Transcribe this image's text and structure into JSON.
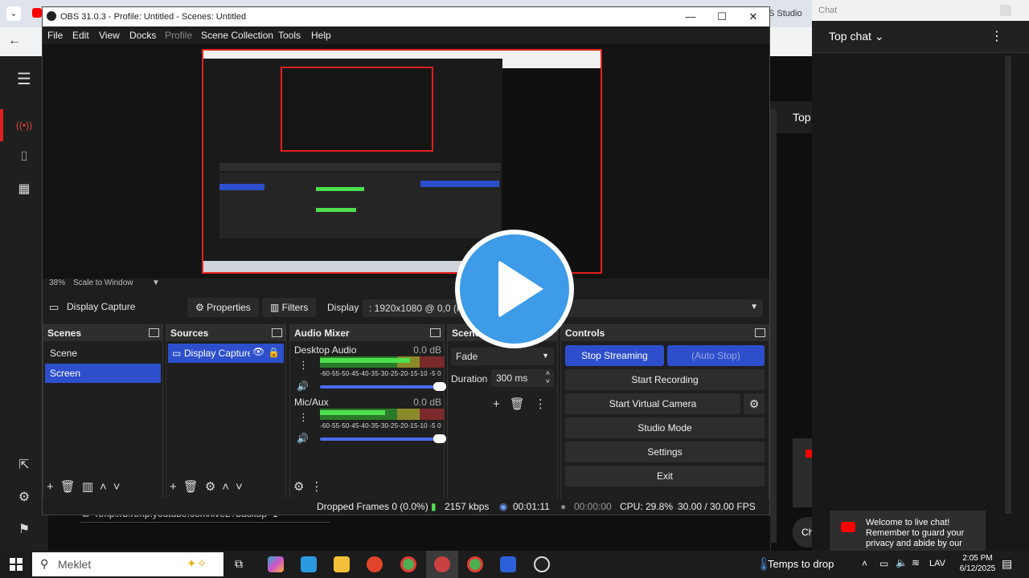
{
  "obs": {
    "title": "OBS 31.0.3 - Profile: Untitled - Scenes: Untitled",
    "menu": [
      "File",
      "Edit",
      "View",
      "Docks",
      "Profile",
      "Scene Collection",
      "Tools",
      "Help"
    ],
    "scale_percent": "38%",
    "scale_mode": "Scale to Window",
    "source_toolbar": {
      "source_name": "Display Capture",
      "properties": "Properties",
      "filters": "Filters",
      "display_label": "Display",
      "display_value": ": 1920x1080 @ 0,0 (Pri"
    },
    "scenes": {
      "title": "Scenes",
      "items": [
        "Scene",
        "Screen"
      ],
      "selected": "Screen"
    },
    "sources": {
      "title": "Sources",
      "items": [
        "Display Capture"
      ]
    },
    "audio_mixer": {
      "title": "Audio Mixer",
      "channels": [
        {
          "name": "Desktop Audio",
          "db": "0.0 dB",
          "level": 0.72
        },
        {
          "name": "Mic/Aux",
          "db": "0.0 dB",
          "level": 0.52
        }
      ],
      "scale": "-60-55-50-45-40-35-30-25-20-15-10 -5  0"
    },
    "transitions": {
      "title": "Scene Transitions",
      "title_visible": "Scene",
      "type": "Fade",
      "duration_label": "Duration",
      "duration": "300 ms"
    },
    "controls": {
      "title": "Controls",
      "stop_streaming": "Stop Streaming",
      "auto_stop": "(Auto Stop)",
      "start_recording": "Start Recording",
      "start_virtual_camera": "Start Virtual Camera",
      "studio_mode": "Studio Mode",
      "settings": "Settings",
      "exit": "Exit"
    },
    "status": {
      "dropped_frames": "Dropped Frames 0 (0.0%)",
      "bitrate": "2157 kbps",
      "stream_time": "00:01:11",
      "record_time": "00:00:00",
      "cpu": "CPU: 29.8%",
      "fps": "30.00 / 30.00 FPS"
    }
  },
  "browser": {
    "partial_tab": "S Studio",
    "stream_url": "rtmp://b.rtmp.youtube.com/live2?backup=1",
    "top_label": "Top",
    "ch_label": "Ch"
  },
  "chat": {
    "top_bar": "Chat",
    "title": "Top chat",
    "welcome": "Welcome to live chat! Remember to guard your privacy and abide by our"
  },
  "taskbar": {
    "search_placeholder": "Meklet",
    "weather": "Temps to drop",
    "lang": "LAV",
    "time": "2:05 PM",
    "date": "6/12/2025"
  },
  "colors": {
    "accent_blue": "#2d4fcc",
    "record_red": "#e02020",
    "play_blue": "#3d9be8"
  }
}
